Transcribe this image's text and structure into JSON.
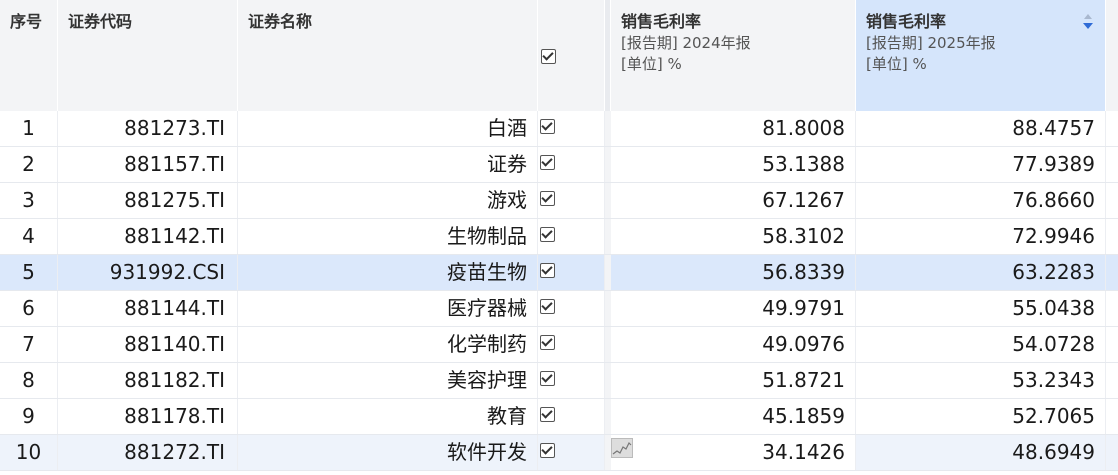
{
  "columns": {
    "index": "序号",
    "code": "证券代码",
    "name": "证券名称",
    "gpm_2024": {
      "title": "销售毛利率",
      "period": "[报告期]  2024年报",
      "unit": "[单位]  %"
    },
    "gpm_2025": {
      "title": "销售毛利率",
      "period": "[报告期]  2025年报",
      "unit": "[单位]  %"
    }
  },
  "sort": {
    "column": "gpm_2025",
    "direction": "descending"
  },
  "rows": [
    {
      "index": "1",
      "code": "881273.TI",
      "name": "白酒",
      "checked": true,
      "gpm_2024": "81.8008",
      "gpm_2025": "88.4757"
    },
    {
      "index": "2",
      "code": "881157.TI",
      "name": "证券",
      "checked": true,
      "gpm_2024": "53.1388",
      "gpm_2025": "77.9389"
    },
    {
      "index": "3",
      "code": "881275.TI",
      "name": "游戏",
      "checked": true,
      "gpm_2024": "67.1267",
      "gpm_2025": "76.8660"
    },
    {
      "index": "4",
      "code": "881142.TI",
      "name": "生物制品",
      "checked": true,
      "gpm_2024": "58.3102",
      "gpm_2025": "72.9946"
    },
    {
      "index": "5",
      "code": "931992.CSI",
      "name": "疫苗生物",
      "checked": true,
      "gpm_2024": "56.8339",
      "gpm_2025": "63.2283"
    },
    {
      "index": "6",
      "code": "881144.TI",
      "name": "医疗器械",
      "checked": true,
      "gpm_2024": "49.9791",
      "gpm_2025": "55.0438"
    },
    {
      "index": "7",
      "code": "881140.TI",
      "name": "化学制药",
      "checked": true,
      "gpm_2024": "49.0976",
      "gpm_2025": "54.0728"
    },
    {
      "index": "8",
      "code": "881182.TI",
      "name": "美容护理",
      "checked": true,
      "gpm_2024": "51.8721",
      "gpm_2025": "53.2343"
    },
    {
      "index": "9",
      "code": "881178.TI",
      "name": "教育",
      "checked": true,
      "gpm_2024": "45.1859",
      "gpm_2025": "52.7065"
    },
    {
      "index": "10",
      "code": "881272.TI",
      "name": "软件开发",
      "checked": true,
      "gpm_2024": "34.1426",
      "gpm_2025": "48.6949"
    }
  ],
  "colors": {
    "header_bg": "#f3f4f6",
    "sorted_header_bg": "#d5e5fb",
    "selected_row": "#dbe8fb",
    "sort_arrow": "#2f6bd6"
  },
  "icons": {
    "header_checkbox": "checkbox-checked-icon",
    "row_checkbox": "checkbox-checked-icon",
    "sort": "sort-descending-icon",
    "sparkline": "sparkline-chart-icon"
  }
}
